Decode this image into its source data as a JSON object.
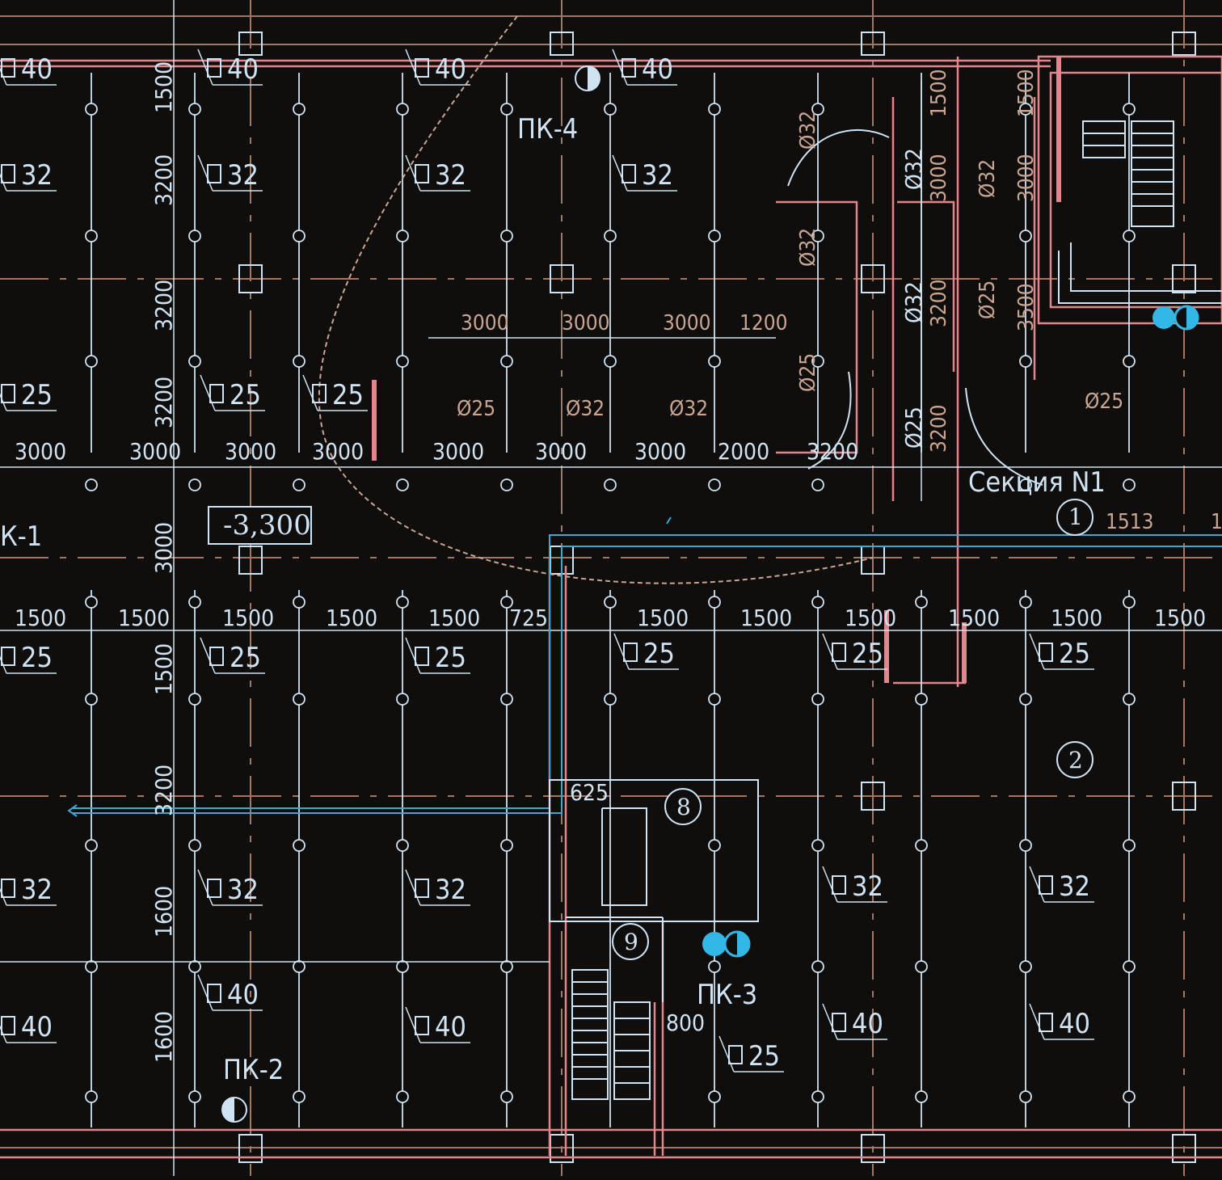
{
  "colors": {
    "background": "#100e0d",
    "pipe_pink": "#e0868c",
    "grid_brown": "#a07866",
    "line_light": "#cfe3f2",
    "accent_cyan": "#33b7e6",
    "text_light": "#cfe3f2",
    "text_brown": "#c9a592"
  },
  "labels": {
    "pk4": "ПК-4",
    "pk1": "К-1",
    "pk2": "ПК-2",
    "pk3": "ПК-3",
    "section": "Секция N1",
    "elevation": "-3,300",
    "circle1": "1",
    "circle2": "2",
    "circle8": "8",
    "circle9": "9",
    "dim1513": "1513",
    "dim1513b": "1",
    "dim625": "625",
    "dim800": "800"
  },
  "square_marks": [
    {
      "id": "sq-r1-c1",
      "text": "40"
    },
    {
      "id": "sq-r1-c2",
      "text": "40"
    },
    {
      "id": "sq-r1-c3",
      "text": "40"
    },
    {
      "id": "sq-r1-c4",
      "text": "40"
    },
    {
      "id": "sq-r2-c1",
      "text": "32"
    },
    {
      "id": "sq-r2-c2",
      "text": "32"
    },
    {
      "id": "sq-r2-c3",
      "text": "32"
    },
    {
      "id": "sq-r2-c4",
      "text": "32"
    },
    {
      "id": "sq-r3-c1",
      "text": "25"
    },
    {
      "id": "sq-r3-c2",
      "text": "25"
    },
    {
      "id": "sq-r3-c3",
      "text": "25"
    },
    {
      "id": "sq-r4-c1",
      "text": "25"
    },
    {
      "id": "sq-r4-c2",
      "text": "25"
    },
    {
      "id": "sq-r4-c3",
      "text": "25"
    },
    {
      "id": "sq-r4-c4",
      "text": "25"
    },
    {
      "id": "sq-r4-c5",
      "text": "25"
    },
    {
      "id": "sq-r4-c6",
      "text": "25"
    },
    {
      "id": "sq-r5-c1",
      "text": "32"
    },
    {
      "id": "sq-r5-c2",
      "text": "32"
    },
    {
      "id": "sq-r5-c3",
      "text": "32"
    },
    {
      "id": "sq-r5-c4",
      "text": "32"
    },
    {
      "id": "sq-r5-c5",
      "text": "32"
    },
    {
      "id": "sq-r6-c2",
      "text": "40"
    },
    {
      "id": "sq-r7-c1",
      "text": "40"
    },
    {
      "id": "sq-r7-c3",
      "text": "40"
    },
    {
      "id": "sq-r7-c4",
      "text": "40"
    },
    {
      "id": "sq-r7-c5",
      "text": "40"
    },
    {
      "id": "sq-r7-c6",
      "text": "25"
    }
  ],
  "dims_row_3000": [
    "3000",
    "3000",
    "3000",
    "3000",
    "3000",
    "3000",
    "3000",
    "2000",
    "3200"
  ],
  "dims_row_upper": [
    "3000",
    "3000",
    "3000",
    "1200"
  ],
  "dims_row_pipes": [
    "Ø25",
    "Ø32",
    "Ø32"
  ],
  "dims_row_1500": [
    "1500",
    "1500",
    "1500",
    "1500",
    "1500",
    "725",
    "1500",
    "1500",
    "1500",
    "1500",
    "1500",
    "1500"
  ],
  "dims_vertical_left": [
    "1500",
    "3200",
    "3200",
    "3200",
    "3000",
    "1500",
    "3200",
    "1600",
    "1600"
  ],
  "dims_vertical_right_a": [
    "Ø32",
    "Ø32",
    "Ø25"
  ],
  "dims_vertical_right_b": [
    "1500",
    "Ø32",
    "3000",
    "Ø32",
    "3200",
    "Ø25",
    "3200"
  ],
  "dims_vertical_right_c": [
    "Ø32",
    "Ø25",
    "1500",
    "3000",
    "3500"
  ],
  "dim_right_phi25": "Ø25"
}
